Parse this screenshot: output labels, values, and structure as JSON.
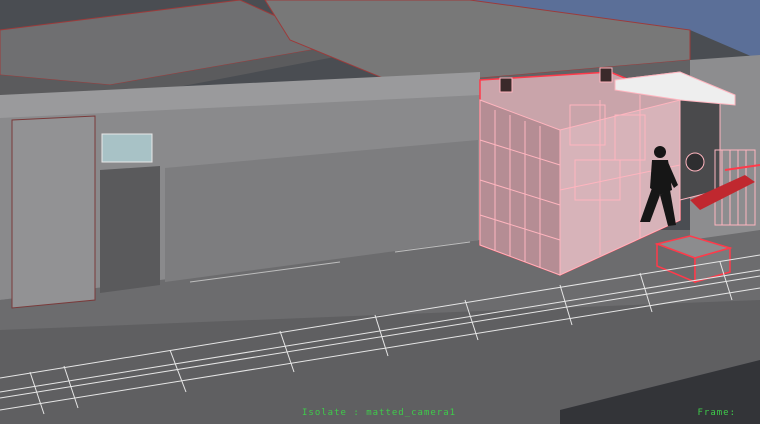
{
  "viewport": {
    "isolate_label": "Isolate",
    "isolate_separator": ":",
    "camera_name": "matted_camera1",
    "frame_label": "Frame:"
  },
  "colors": {
    "background": "#4a4d52",
    "ground": "#6c6c6e",
    "wall": "#8a8a8c",
    "wire_selected": "#ff3a4a",
    "wire_pink": "#ffb5bf",
    "hud_text": "#3ecb4a"
  }
}
